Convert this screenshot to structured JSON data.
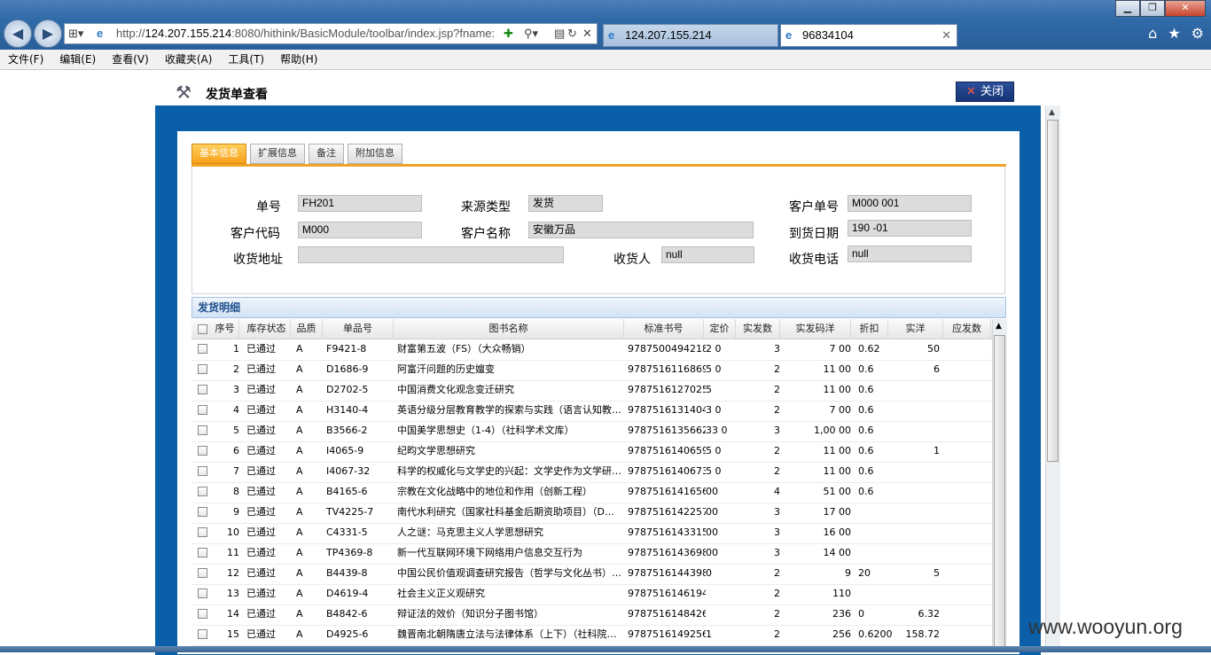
{
  "browser": {
    "address_host": "124.207.155.214",
    "address_rest": ":8080/hithink/BasicModule/toolbar/index.jsp?fname:",
    "tabs": [
      {
        "label": "124.207.155.214",
        "active": false
      },
      {
        "label": "96834104",
        "active": true
      }
    ],
    "menu": [
      "文件(F)",
      "编辑(E)",
      "查看(V)",
      "收藏夹(A)",
      "工具(T)",
      "帮助(H)"
    ]
  },
  "page": {
    "title": "发货单查看",
    "close_label": "关闭",
    "tabs": [
      "基本信息",
      "扩展信息",
      "备注",
      "附加信息"
    ],
    "form": {
      "order_no_label": "单号",
      "order_no": "FH201",
      "source_type_label": "来源类型",
      "source_type": "发货",
      "customer_order_label": "客户单号",
      "customer_order": "M000      001",
      "customer_code_label": "客户代码",
      "customer_code": "M000",
      "customer_name_label": "客户名称",
      "customer_name": "安徽万品",
      "arrival_date_label": "到货日期",
      "arrival_date": "190      -01",
      "address_label": "收货地址",
      "address": "",
      "receiver_label": "收货人",
      "receiver": "null",
      "phone_label": "收货电话",
      "phone": "null"
    },
    "grid": {
      "title": "发货明细",
      "headers": [
        "序号",
        "库存状态",
        "品质",
        "单品号",
        "图书名称",
        "标准书号",
        "定价",
        "实发数",
        "实发码洋",
        "折扣",
        "实洋",
        "应发数"
      ],
      "rows": [
        {
          "no": "1",
          "status": "已通过",
          "quality": "A",
          "sku": "F9421-8",
          "name": "财富第五波（FS）（大众畅销）",
          "isbn": "9787500494218",
          "price": "2   0",
          "qty": "3",
          "gross": "7   00",
          "discount": "0.62",
          "net": "  50"
        },
        {
          "no": "2",
          "status": "已通过",
          "quality": "A",
          "sku": "D1686-9",
          "name": "阿富汗问题的历史嬗变",
          "isbn": "9787516116869",
          "price": "5   0",
          "qty": "2",
          "gross": "11   00",
          "discount": "0.6",
          "net": "  6"
        },
        {
          "no": "3",
          "status": "已通过",
          "quality": "A",
          "sku": "D2702-5",
          "name": "中国消费文化观念变迁研究",
          "isbn": "9787516127025",
          "price": "5",
          "qty": "2",
          "gross": "11   00",
          "discount": "0.6",
          "net": ""
        },
        {
          "no": "4",
          "status": "已通过",
          "quality": "A",
          "sku": "H3140-4",
          "name": "英语分级分层教育教学的探索与实践（语言认知教…",
          "isbn": "9787516131404",
          "price": "3   0",
          "qty": "2",
          "gross": "7   00",
          "discount": "0.6",
          "net": ""
        },
        {
          "no": "5",
          "status": "已通过",
          "quality": "A",
          "sku": "B3566-2",
          "name": "中国美学思想史（1-4）（社科学术文库）",
          "isbn": "9787516135662",
          "price": "33   0",
          "qty": "3",
          "gross": "1,00   00",
          "discount": "0.6",
          "net": ""
        },
        {
          "no": "6",
          "status": "已通过",
          "quality": "A",
          "sku": "I4065-9",
          "name": "纪昀文学思想研究",
          "isbn": "9787516140659",
          "price": "5   0",
          "qty": "2",
          "gross": "11   00",
          "discount": "0.6",
          "net": "1"
        },
        {
          "no": "7",
          "status": "已通过",
          "quality": "A",
          "sku": "I4067-32",
          "name": "科学的权威化与文学史的兴起：文学史作为文学研…",
          "isbn": "9787516140673",
          "price": "5   0",
          "qty": "2",
          "gross": "11   00",
          "discount": "0.6",
          "net": ""
        },
        {
          "no": "8",
          "status": "已通过",
          "quality": "A",
          "sku": "B4165-6",
          "name": "宗教在文化战略中的地位和作用（创新工程）",
          "isbn": "9787516141656",
          "price": "  00",
          "qty": "4",
          "gross": "51   00",
          "discount": "0.6",
          "net": ""
        },
        {
          "no": "9",
          "status": "已通过",
          "quality": "A",
          "sku": "TV4225-7",
          "name": "南代水利研究（国家社科基金后期资助项目）（D…",
          "isbn": "9787516142257",
          "price": "  00",
          "qty": "3",
          "gross": "17   00",
          "discount": "",
          "net": ""
        },
        {
          "no": "10",
          "status": "已通过",
          "quality": "A",
          "sku": "C4331-5",
          "name": "人之谜：马克思主义人学思想研究",
          "isbn": "9787516143315",
          "price": "  00",
          "qty": "3",
          "gross": "16   00",
          "discount": "",
          "net": ""
        },
        {
          "no": "11",
          "status": "已通过",
          "quality": "A",
          "sku": "TP4369-8",
          "name": "新一代互联网环境下网络用户信息交互行为",
          "isbn": "9787516143698",
          "price": "  00",
          "qty": "3",
          "gross": "14   00",
          "discount": "",
          "net": ""
        },
        {
          "no": "12",
          "status": "已通过",
          "quality": "A",
          "sku": "B4439-8",
          "name": "中国公民价值观调查研究报告（哲学与文化丛书）…",
          "isbn": "9787516144398",
          "price": "  0",
          "qty": "2",
          "gross": "9",
          "discount": "  20",
          "net": "5"
        },
        {
          "no": "13",
          "status": "已通过",
          "quality": "A",
          "sku": "D4619-4",
          "name": "社会主义正义观研究",
          "isbn": "9787516146194",
          "price": "",
          "qty": "2",
          "gross": "110",
          "discount": "",
          "net": ""
        },
        {
          "no": "14",
          "status": "已通过",
          "quality": "A",
          "sku": "B4842-6",
          "name": "辩证法的效价（知识分子图书馆）",
          "isbn": "9787516148426",
          "price": "",
          "qty": "2",
          "gross": "236",
          "discount": "  0",
          "net": "  6.32"
        },
        {
          "no": "15",
          "status": "已通过",
          "quality": "A",
          "sku": "D4925-6",
          "name": "魏晋南北朝隋唐立法与法律体系（上下）（社科院…",
          "isbn": "9787516149256",
          "price": "1",
          "qty": "2",
          "gross": "256",
          "discount": "0.6200",
          "net": "158.72"
        }
      ]
    }
  },
  "watermark": "www.wooyun.org"
}
